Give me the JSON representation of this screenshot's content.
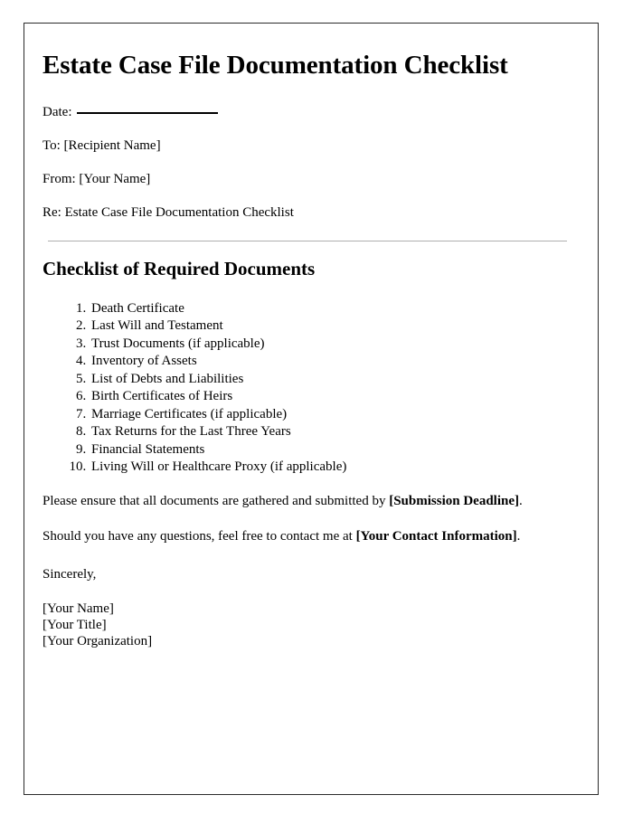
{
  "document": {
    "title": "Estate Case File Documentation Checklist",
    "date_label": "Date:",
    "to_line": "To: [Recipient Name]",
    "from_line": "From: [Your Name]",
    "re_line": "Re: Estate Case File Documentation Checklist",
    "section_title": "Checklist of Required Documents",
    "checklist": [
      "Death Certificate",
      "Last Will and Testament",
      "Trust Documents (if applicable)",
      "Inventory of Assets",
      "List of Debts and Liabilities",
      "Birth Certificates of Heirs",
      "Marriage Certificates (if applicable)",
      "Tax Returns for the Last Three Years",
      "Financial Statements",
      "Living Will or Healthcare Proxy (if applicable)"
    ],
    "paragraph_deadline": {
      "prefix": "Please ensure that all documents are gathered and submitted by ",
      "placeholder": "[Submission Deadline]",
      "suffix": "."
    },
    "paragraph_contact": {
      "prefix": "Should you have any questions, feel free to contact me at ",
      "placeholder": "[Your Contact Information]",
      "suffix": "."
    },
    "closing": "Sincerely,",
    "signature": {
      "name": "[Your Name]",
      "title": "[Your Title]",
      "organization": "[Your Organization]"
    }
  }
}
